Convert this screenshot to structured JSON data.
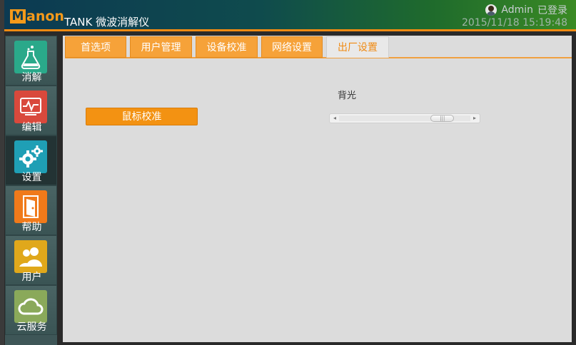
{
  "header": {
    "logo_text": "anon",
    "logo_letter": "M",
    "app_title": "TANK 微波消解仪",
    "user_name": "Admin",
    "login_status": "已登录",
    "datetime": "2015/11/18 15:19:48"
  },
  "sidebar": {
    "items": [
      {
        "label": "消解",
        "icon": "flask-icon",
        "color": "#2aa98a"
      },
      {
        "label": "编辑",
        "icon": "chart-edit-icon",
        "color": "#d9493c"
      },
      {
        "label": "设置",
        "icon": "gears-icon",
        "color": "#1f9fb5"
      },
      {
        "label": "帮助",
        "icon": "help-door-icon",
        "color": "#f07a1a"
      },
      {
        "label": "用户",
        "icon": "users-icon",
        "color": "#e0a81b"
      },
      {
        "label": "云服务",
        "icon": "cloud-icon",
        "color": "#8aa95a"
      }
    ],
    "active_index": 2
  },
  "tabs": [
    {
      "label": "首选项"
    },
    {
      "label": "用户管理"
    },
    {
      "label": "设备校准"
    },
    {
      "label": "网络设置"
    },
    {
      "label": "出厂设置"
    }
  ],
  "active_tab_index": 4,
  "factory": {
    "calibrate_button": "鼠标校准",
    "backlight_label": "背光",
    "backlight_value_fraction": 0.85
  },
  "colors": {
    "accent": "#f39212",
    "header_start": "#0c3a52",
    "header_end": "#3a8a24"
  }
}
